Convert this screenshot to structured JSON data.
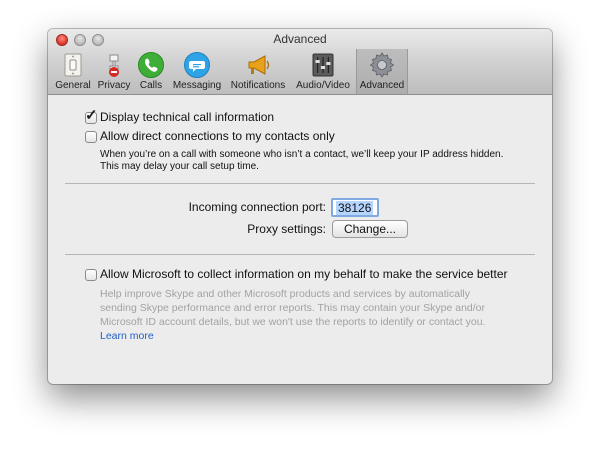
{
  "window": {
    "title": "Advanced"
  },
  "toolbar": {
    "tabs": [
      {
        "label": "General",
        "icon": "light-switch-icon"
      },
      {
        "label": "Privacy",
        "icon": "privacy-icon"
      },
      {
        "label": "Calls",
        "icon": "phone-icon"
      },
      {
        "label": "Messaging",
        "icon": "chat-bubble-icon"
      },
      {
        "label": "Notifications",
        "icon": "megaphone-icon"
      },
      {
        "label": "Audio/Video",
        "icon": "mixer-icon"
      },
      {
        "label": "Advanced",
        "icon": "gear-icon",
        "selected": true
      }
    ]
  },
  "options": {
    "display_technical": {
      "label": "Display technical call information",
      "checked": true
    },
    "direct_connections": {
      "label": "Allow direct connections to my contacts only",
      "checked": false,
      "note_line1": "When you’re on a call with someone who isn’t a contact, we’ll keep your IP address hidden.",
      "note_line2": "This may delay your call setup time."
    },
    "incoming_port": {
      "label": "Incoming connection port:",
      "value": "38126"
    },
    "proxy": {
      "label": "Proxy settings:",
      "button": "Change..."
    },
    "microsoft_collect": {
      "label": "Allow Microsoft to collect information on my behalf to make the service better",
      "checked": false,
      "desc_line1": "Help improve Skype and other Microsoft products and services by automatically",
      "desc_line2": "sending Skype performance and error reports. This may contain your Skype and/or",
      "desc_line3": "Microsoft ID account details, but we won't use the reports to identify or contact you.",
      "learn_more": "Learn more"
    }
  },
  "colors": {
    "accent_link": "#2461c4",
    "selection": "#b5d5ff",
    "close_button": "#d9342b"
  }
}
